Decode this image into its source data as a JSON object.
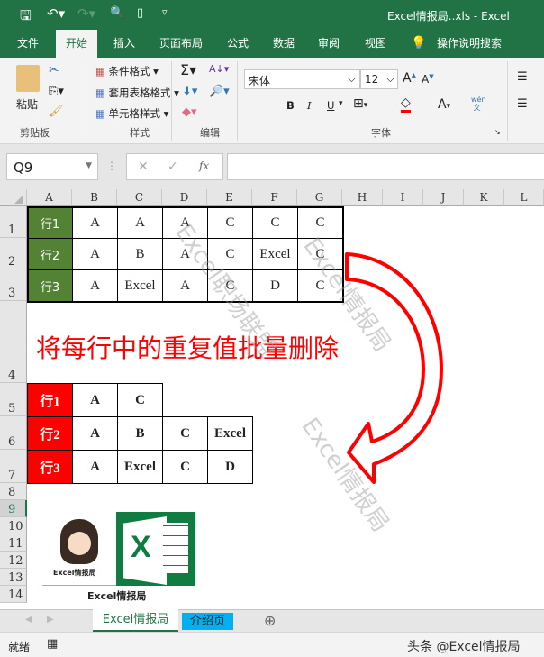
{
  "window": {
    "title": "Excel情报局..xls  -  Excel"
  },
  "tabs": [
    "文件",
    "开始",
    "插入",
    "页面布局",
    "公式",
    "数据",
    "审阅",
    "视图"
  ],
  "tell_me": "操作说明搜索",
  "ribbon": {
    "clipboard": {
      "paste": "粘贴",
      "group": "剪贴板"
    },
    "styles": {
      "conditional": "条件格式",
      "table": "套用表格格式",
      "cell": "单元格样式",
      "group": "样式"
    },
    "editing": {
      "group": "编辑"
    },
    "font": {
      "name": "宋体",
      "size": "12",
      "bold": "B",
      "italic": "I",
      "underline": "U",
      "group": "字体",
      "phonetic": "wén"
    }
  },
  "formula_bar": {
    "name_box": "Q9",
    "fx": "fx",
    "value": ""
  },
  "columns": [
    "A",
    "B",
    "C",
    "D",
    "E",
    "F",
    "G",
    "H",
    "I",
    "J",
    "K",
    "L"
  ],
  "rows": [
    "1",
    "2",
    "3",
    "4",
    "5",
    "6",
    "7",
    "8",
    "9",
    "10",
    "11",
    "12",
    "13",
    "14"
  ],
  "table1": [
    [
      "行1",
      "A",
      "A",
      "A",
      "C",
      "C",
      "C"
    ],
    [
      "行2",
      "A",
      "B",
      "A",
      "C",
      "Excel",
      "C"
    ],
    [
      "行3",
      "A",
      "Excel",
      "A",
      "C",
      "D",
      "C"
    ]
  ],
  "heading": "将每行中的重复值批量删除",
  "table2": [
    [
      "行1",
      "A",
      "C"
    ],
    [
      "行2",
      "A",
      "B",
      "C",
      "Excel"
    ],
    [
      "行3",
      "A",
      "Excel",
      "C",
      "D"
    ]
  ],
  "logo": {
    "caption": "Excel情报局",
    "avatar_caption": "Excel情报局"
  },
  "watermarks": [
    "Excel职场联盟",
    "Excel情报局"
  ],
  "sheet_tabs": [
    "Excel情报局",
    "介绍页"
  ],
  "status": {
    "ready": "就绪",
    "credit": "头条 @Excel情报局"
  },
  "colors": {
    "accent": "#217346",
    "row_green": "#548235",
    "row_red": "#ff0000",
    "tab2": "#00b0f0"
  }
}
